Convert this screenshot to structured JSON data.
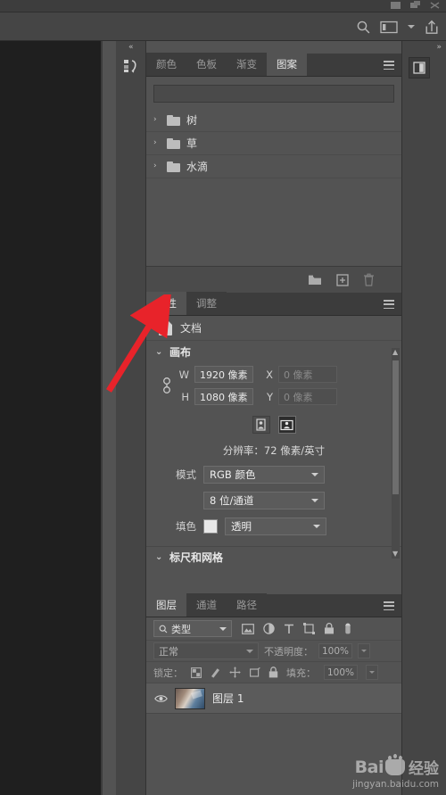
{
  "app": {
    "name": "Adobe Photoshop",
    "accent_red": "#e8232a",
    "panel_bg": "#535353",
    "tabbar_bg": "#3c3c3c"
  },
  "topbar": {
    "icons": [
      "document-icon",
      "layers-stack-icon",
      "close-icon"
    ]
  },
  "optionbar": {
    "search_icon": "search-icon",
    "workspace_icon": "workspace-icon",
    "workspace_chevron": "chevron-down-icon",
    "share_icon": "share-export-icon"
  },
  "left_rail": {
    "collapse_label": "«",
    "icon": "history-actions-icon"
  },
  "right_rail": {
    "collapse_label": "»",
    "icon": "collapsed-panel-icon"
  },
  "patterns_panel": {
    "tabs": [
      {
        "label": "颜色",
        "name": "tab-color",
        "active": false
      },
      {
        "label": "色板",
        "name": "tab-swatches",
        "active": false
      },
      {
        "label": "渐变",
        "name": "tab-gradients",
        "active": false
      },
      {
        "label": "图案",
        "name": "tab-patterns",
        "active": true
      }
    ],
    "search_placeholder": "",
    "folders": [
      {
        "twisty": "›",
        "label": "树"
      },
      {
        "twisty": "›",
        "label": "草"
      },
      {
        "twisty": "›",
        "label": "水滴"
      }
    ],
    "footer_icons": [
      "new-folder-icon",
      "new-pattern-icon",
      "delete-icon"
    ],
    "menu_icon": "panel-menu-icon"
  },
  "properties_panel": {
    "tabs": [
      {
        "label": "属性",
        "name": "tab-properties",
        "active": true
      },
      {
        "label": "调整",
        "name": "tab-adjustments",
        "active": false
      }
    ],
    "menu_icon": "panel-menu-icon",
    "document_row": {
      "icon": "document-icon",
      "label": "文档"
    },
    "canvas_section": {
      "chevron": "⌄",
      "title": "画布",
      "link_icon": "link-dimensions-icon",
      "w_label": "W",
      "w_value": "1920 像素",
      "h_label": "H",
      "h_value": "1080 像素",
      "x_label": "X",
      "x_value": "0 像素",
      "y_label": "Y",
      "y_value": "0 像素",
      "orientation": [
        "portrait-icon",
        "landscape-icon"
      ],
      "orientation_selected": 1,
      "resolution": "分辨率：72 像素/英寸",
      "mode_label": "模式",
      "mode_value": "RGB 颜色",
      "depth_value": "8 位/通道",
      "fill_label": "填色",
      "fill_swatch": "#e8e8e8",
      "fill_value": "透明"
    },
    "rulers_section": {
      "chevron": "⌄",
      "title": "标尺和网格"
    }
  },
  "layers_panel": {
    "tabs": [
      {
        "label": "图层",
        "name": "tab-layers",
        "active": true
      },
      {
        "label": "通道",
        "name": "tab-channels",
        "active": false
      },
      {
        "label": "路径",
        "name": "tab-paths",
        "active": false
      }
    ],
    "menu_icon": "panel-menu-icon",
    "filter": {
      "search_icon": "search-icon",
      "kind_label": "类型",
      "chevron": "chevron-down-icon",
      "icons": [
        "image-filter-icon",
        "adjustment-filter-icon",
        "type-filter-icon",
        "shape-filter-icon",
        "smart-object-filter-icon",
        "toggle-filter-icon"
      ]
    },
    "blend": {
      "mode": "正常",
      "opacity_label": "不透明度：",
      "opacity_value": "100%"
    },
    "lock": {
      "label": "锁定：",
      "icons": [
        "lock-transparency-icon",
        "lock-image-icon",
        "lock-position-icon",
        "lock-artboard-icon",
        "lock-all-icon"
      ],
      "fill_label": "填充：",
      "fill_value": "100%"
    },
    "layers": [
      {
        "visible": true,
        "eye_icon": "eye-icon",
        "thumbnail": "layer-thumbnail",
        "name": "图层 1"
      }
    ]
  },
  "watermark": {
    "brand": "Bai",
    "suffix": "经验",
    "url": "jingyan.baidu.com"
  },
  "annotation": {
    "arrow_color": "#e8232a",
    "points_to": "tab-properties"
  }
}
